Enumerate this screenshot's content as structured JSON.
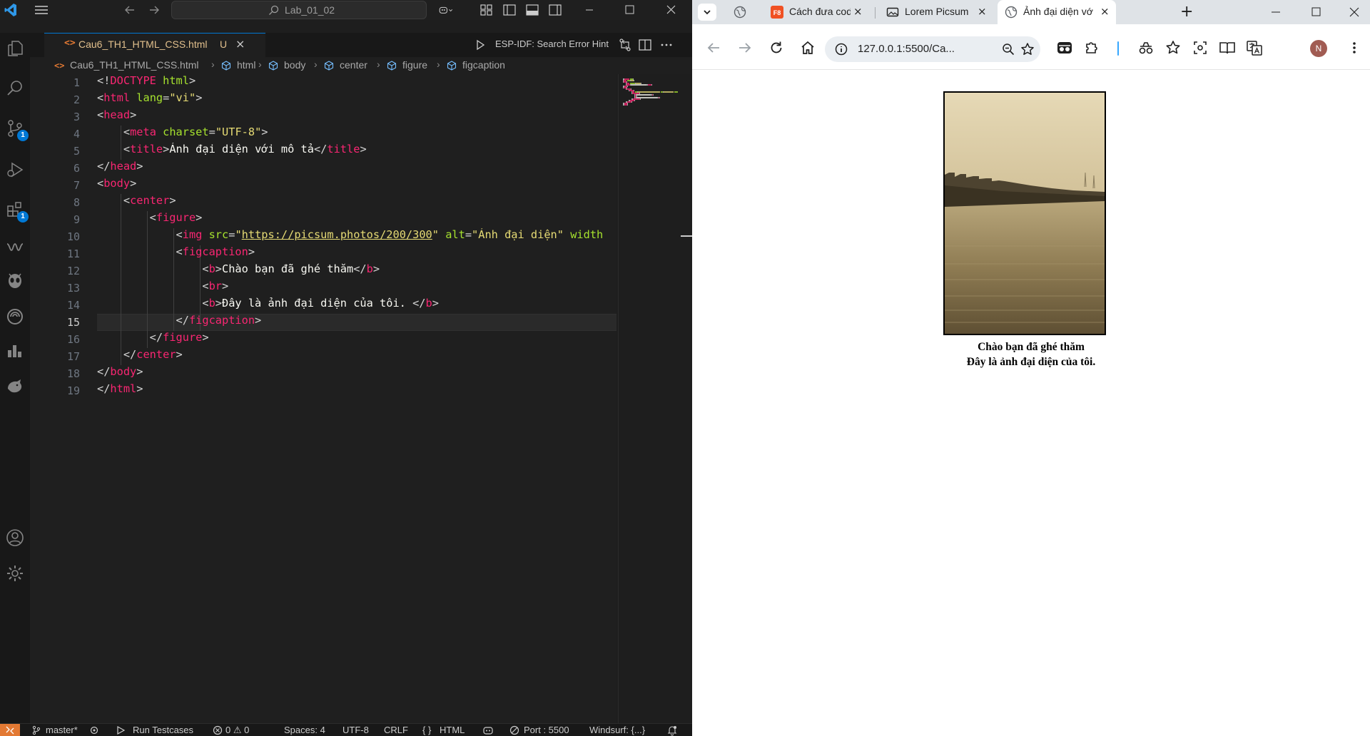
{
  "vscode": {
    "titlebar": {
      "search_text": "Lab_01_02"
    },
    "activity_bar": {
      "scm_badge": "1",
      "extensions_badge": "1"
    },
    "tab": {
      "filename": "Cau6_TH1_HTML_CSS.html",
      "status": "U",
      "close": "×",
      "run_label": "ESP-IDF: Search Error Hint",
      "file_icon": "<>"
    },
    "breadcrumb": {
      "file": "Cau6_TH1_HTML_CSS.html",
      "items": [
        "html",
        "body",
        "center",
        "figure",
        "figcaption"
      ]
    },
    "editor": {
      "active_line": 15,
      "lines": [
        [
          [
            "br",
            "<!"
          ],
          [
            "tag",
            "DOCTYPE"
          ],
          [
            "br",
            " "
          ],
          [
            "attr",
            "html"
          ],
          [
            "br",
            ">"
          ]
        ],
        [
          [
            "br",
            "<"
          ],
          [
            "tag",
            "html"
          ],
          [
            "br",
            " "
          ],
          [
            "attr",
            "lang"
          ],
          [
            "br",
            "="
          ],
          [
            "str",
            "\"vi\""
          ],
          [
            "br",
            ">"
          ]
        ],
        [
          [
            "br",
            "<"
          ],
          [
            "tag",
            "head"
          ],
          [
            "br",
            ">"
          ]
        ],
        [
          [
            "br",
            "    <"
          ],
          [
            "tag",
            "meta"
          ],
          [
            "br",
            " "
          ],
          [
            "attr",
            "charset"
          ],
          [
            "br",
            "="
          ],
          [
            "str",
            "\"UTF-8\""
          ],
          [
            "br",
            ">"
          ]
        ],
        [
          [
            "br",
            "    <"
          ],
          [
            "tag",
            "title"
          ],
          [
            "br",
            ">"
          ],
          [
            "txt",
            "Ảnh đại diện với mô tả"
          ],
          [
            "br",
            "</"
          ],
          [
            "tag",
            "title"
          ],
          [
            "br",
            ">"
          ]
        ],
        [
          [
            "br",
            "</"
          ],
          [
            "tag",
            "head"
          ],
          [
            "br",
            ">"
          ]
        ],
        [
          [
            "br",
            "<"
          ],
          [
            "tag",
            "body"
          ],
          [
            "br",
            ">"
          ]
        ],
        [
          [
            "br",
            "    <"
          ],
          [
            "tag",
            "center"
          ],
          [
            "br",
            ">"
          ]
        ],
        [
          [
            "br",
            "        <"
          ],
          [
            "tag",
            "figure"
          ],
          [
            "br",
            ">"
          ]
        ],
        [
          [
            "br",
            "            <"
          ],
          [
            "tag",
            "img"
          ],
          [
            "br",
            " "
          ],
          [
            "attr",
            "src"
          ],
          [
            "br",
            "="
          ],
          [
            "str",
            "\""
          ],
          [
            "url",
            "https://picsum.photos/200/300"
          ],
          [
            "str",
            "\""
          ],
          [
            "br",
            " "
          ],
          [
            "attr",
            "alt"
          ],
          [
            "br",
            "="
          ],
          [
            "str",
            "\"Ảnh đại diện\""
          ],
          [
            "br",
            " "
          ],
          [
            "attr",
            "width"
          ]
        ],
        [
          [
            "br",
            "            <"
          ],
          [
            "tag",
            "figcaption"
          ],
          [
            "br",
            ">"
          ]
        ],
        [
          [
            "br",
            "                <"
          ],
          [
            "tag",
            "b"
          ],
          [
            "br",
            ">"
          ],
          [
            "txt",
            "Chào bạn đã ghé thăm"
          ],
          [
            "br",
            "</"
          ],
          [
            "tag",
            "b"
          ],
          [
            "br",
            ">"
          ]
        ],
        [
          [
            "br",
            "                <"
          ],
          [
            "tag",
            "br"
          ],
          [
            "br",
            ">"
          ]
        ],
        [
          [
            "br",
            "                <"
          ],
          [
            "tag",
            "b"
          ],
          [
            "br",
            ">"
          ],
          [
            "txt",
            "Đây là ảnh đại diện của tôi. "
          ],
          [
            "br",
            "</"
          ],
          [
            "tag",
            "b"
          ],
          [
            "br",
            ">"
          ]
        ],
        [
          [
            "br",
            "            </"
          ],
          [
            "tag",
            "figcaption"
          ],
          [
            "br",
            ">"
          ]
        ],
        [
          [
            "br",
            "        </"
          ],
          [
            "tag",
            "figure"
          ],
          [
            "br",
            ">"
          ]
        ],
        [
          [
            "br",
            "    </"
          ],
          [
            "tag",
            "center"
          ],
          [
            "br",
            ">"
          ]
        ],
        [
          [
            "br",
            "</"
          ],
          [
            "tag",
            "body"
          ],
          [
            "br",
            ">"
          ]
        ],
        [
          [
            "br",
            "</"
          ],
          [
            "tag",
            "html"
          ],
          [
            "br",
            ">"
          ]
        ]
      ]
    },
    "statusbar": {
      "branch": "master*",
      "run_testcases": "Run Testcases",
      "problems": "0 ⚠ 0",
      "spaces": "Spaces: 4",
      "encoding": "UTF-8",
      "eol": "CRLF",
      "language": "HTML",
      "port": "Port : 5500",
      "windsurf": "Windsurf: {...}"
    }
  },
  "chrome": {
    "tabs": [
      {
        "title": "Cách đưa code",
        "close": "×",
        "favicon": "F8",
        "active": false
      },
      {
        "title": "Lorem Picsum",
        "close": "×",
        "favicon": "image",
        "active": false
      },
      {
        "title": "Ảnh đại diện vớ",
        "close": "×",
        "favicon": "globe",
        "active": true
      }
    ],
    "new_tab": "+",
    "url": "127.0.0.1:5500/Ca...",
    "profile_initial": "N",
    "page": {
      "caption_line1": "Chào bạn đã ghé thăm",
      "caption_line2": "Đây là ảnh đại diện của tôi."
    }
  },
  "colors": {
    "vscode_bg": "#1f1f1f",
    "accent_blue": "#0078d4",
    "tag": "#f92672",
    "attr": "#a6e22e",
    "string": "#e6db74",
    "modified": "#e2c08d",
    "remote": "#e37933"
  }
}
